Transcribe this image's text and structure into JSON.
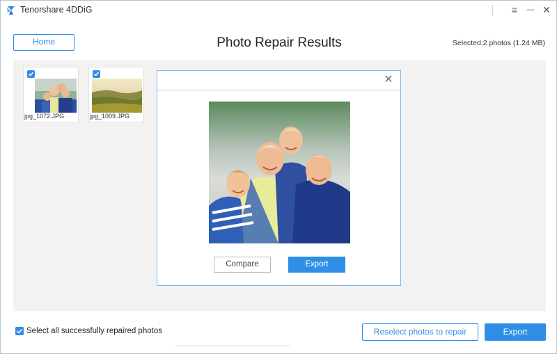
{
  "app": {
    "title": "Tenorshare 4DDiG",
    "logo_icon": "tenorshare-logo-icon",
    "brand_color": "#2f8ee6"
  },
  "window_controls": {
    "menu_icon": "≡",
    "minimize_icon": "—",
    "close_icon": "✕"
  },
  "header": {
    "home_label": "Home",
    "title": "Photo Repair Results",
    "selected_info": "Selected:2 photos (1.24 MB)"
  },
  "photos": [
    {
      "name": "jpg_1072.JPG",
      "checked": true,
      "kind": "family-portrait"
    },
    {
      "name": "jpg_1009.JPG",
      "checked": true,
      "kind": "landscape-field"
    }
  ],
  "preview": {
    "close_icon": "✕",
    "compare_label": "Compare",
    "export_label": "Export"
  },
  "footer": {
    "select_all_label": "Select all successfully repaired photos",
    "select_all_checked": true,
    "reselect_label": "Reselect photos to repair",
    "export_label": "Export"
  }
}
